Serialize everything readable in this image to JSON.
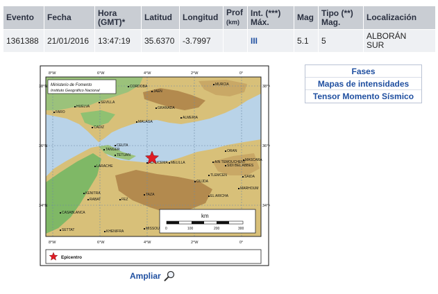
{
  "table": {
    "headers": [
      {
        "label": "Evento",
        "sub": ""
      },
      {
        "label": "Fecha",
        "sub": ""
      },
      {
        "label": "Hora",
        "sub": "(GMT)*"
      },
      {
        "label": "Latitud",
        "sub": ""
      },
      {
        "label": "Longitud",
        "sub": ""
      },
      {
        "label": "Prof",
        "sub": "(km)"
      },
      {
        "label": "Int. (***)",
        "sub": "Máx."
      },
      {
        "label": "Mag",
        "sub": ""
      },
      {
        "label": "Tipo (**)",
        "sub": "Mag."
      },
      {
        "label": "Localización",
        "sub": ""
      }
    ],
    "row": {
      "evento": "1361388",
      "fecha": "21/01/2016",
      "hora": "13:47:19",
      "latitud": "35.6370",
      "longitud": "-3.7997",
      "prof": "",
      "intensidad": "III",
      "mag": "5.1",
      "tipo_mag": "5",
      "localizacion_1": "ALBORÁN",
      "localizacion_2": "SUR"
    }
  },
  "side_links": [
    "Fases",
    "Mapas de intensidades",
    "Tensor Momento Sísmico"
  ],
  "map": {
    "org_line1": "Ministerio de Fomento",
    "org_line2": "Instituto Geográfico Nacional",
    "lon_labels": [
      "8°W",
      "6°W",
      "4°W",
      "2°W",
      "0°"
    ],
    "lat_labels": [
      "38°N",
      "36°N",
      "34°N"
    ],
    "scale_unit": "km",
    "scale_ticks": [
      "0",
      "100",
      "200",
      "300"
    ],
    "legend_label": "Epicentro",
    "colors": {
      "sea": "#b9d3e8",
      "land_low": "#7fb866",
      "land_mid": "#d8c079",
      "land_high": "#b38a4e",
      "epicenter": "#e01b24"
    },
    "places": [
      "CORDOBA",
      "JAEN",
      "MURCIA",
      "HUELVA",
      "SEVILLA",
      "GRANADA",
      "FARO",
      "MALAGA",
      "ALMERIA",
      "CADIZ",
      "CEUTA",
      "TANGER",
      "TETUAN",
      "ORAN",
      "MELILLA",
      "ALHUCEMA",
      "AIN TEMOUCHENT",
      "MASCARA",
      "SIDI BEL ABBES",
      "TLEMCEN",
      "SAIDA",
      "LARACHE",
      "OUJDA",
      "KENITRA",
      "FEZ",
      "MARHOUM",
      "TAZA",
      "RABAT",
      "EL ARICHA",
      "CASABLANCA",
      "MISSOUR",
      "SETTAT",
      "KHENIFRA"
    ]
  },
  "ampliar": "Ampliar"
}
